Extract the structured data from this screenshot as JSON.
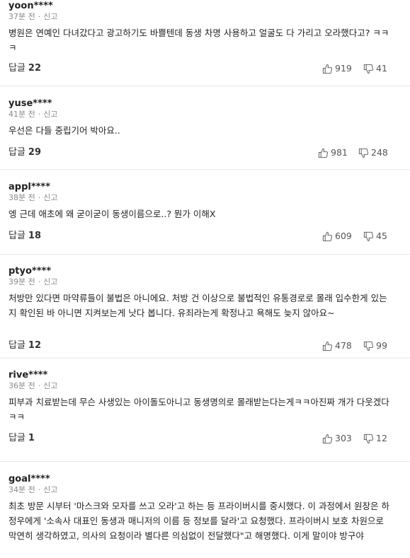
{
  "comments": [
    {
      "author": "yoon****",
      "time": "37분 전",
      "report": "신고",
      "text": "병원은 연예인 다녀갔다고 광고하기도 바쁠텐데 동생 차명 사용하고 얼굴도 다 가리고 오라했다고? ㅋㅋㅋ",
      "reply_label": "답글",
      "reply_count": "22",
      "likes": "919",
      "dislikes": "41"
    },
    {
      "author": "yuse****",
      "time": "41분 전",
      "report": "신고",
      "text": "우선은 다들 중립기어 박아요..",
      "reply_label": "답글",
      "reply_count": "29",
      "likes": "981",
      "dislikes": "248"
    },
    {
      "author": "appl****",
      "time": "38분 전",
      "report": "신고",
      "text": "엥 근데 애초에 왜 굳이굳이 동생이름으로..? 뭔가 이해X",
      "reply_label": "답글",
      "reply_count": "18",
      "likes": "609",
      "dislikes": "45"
    },
    {
      "author": "ptyo****",
      "time": "39분 전",
      "report": "신고",
      "text": "처방만 있다면 마약류들이 불법은 아니에요. 처방 건 이상으로 불법적인 유통경로로 몰래 입수한게 있는지 확인된 바 아니면 지켜보는게 낫다 봅니다. 유죄라는게 확정나고 욕해도 늦지 않아요~",
      "reply_label": "답글",
      "reply_count": "12",
      "likes": "478",
      "dislikes": "99"
    },
    {
      "author": "rive****",
      "time": "36분 전",
      "report": "신고",
      "text": "피부과 치료받는데 무슨 사생있는 아이돌도아니고 동생명의로 몰래받는다는게ㅋㅋ아진짜 개가 다웃겠다ㅋㅋ",
      "reply_label": "답글",
      "reply_count": "1",
      "likes": "303",
      "dislikes": "12"
    },
    {
      "author": "goal****",
      "time": "34분 전",
      "report": "신고",
      "text": "최초 방문 시부터 '마스크와 모자를 쓰고 오라'고 하는 등 프라이버시를 중시했다. 이 과정에서 원장은 하정우에게 '소속사 대표인 동생과 매니저의 이름 등 정보를 달라'고 요청했다. 프라이버시 보호 차원으로 막연히 생각하였고, 의사의 요청이라 별다른 의심없이 전달했다\"고 해명했다. 이게 말이야 방구야",
      "reply_label": "",
      "reply_count": "",
      "likes": "",
      "dislikes": ""
    }
  ]
}
